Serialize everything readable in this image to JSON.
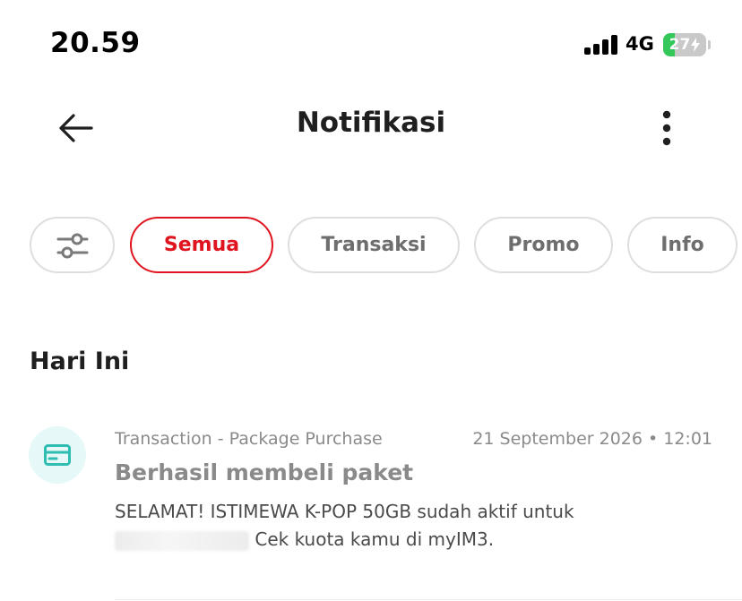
{
  "status_bar": {
    "time": "20.59",
    "network": "4G",
    "battery_percent": 27,
    "battery_label": "27"
  },
  "header": {
    "title": "Notifikasi",
    "back_icon": "arrow-left-icon",
    "more_icon": "more-vertical-icon"
  },
  "filters": {
    "filter_icon": "sliders-icon",
    "chips": [
      {
        "label": "Semua",
        "active": true
      },
      {
        "label": "Transaksi",
        "active": false
      },
      {
        "label": "Promo",
        "active": false
      },
      {
        "label": "Info",
        "active": false
      }
    ]
  },
  "section": {
    "title": "Hari Ini"
  },
  "notifications": [
    {
      "icon": "card-icon",
      "category": "Transaction - Package Purchase",
      "timestamp": "21 September 2026 • 12:01",
      "title": "Berhasil membeli paket",
      "body_line1": "SELAMAT! ISTIMEWA K-POP 50GB sudah aktif untuk",
      "body_line2_suffix": "Cek kuota kamu di myIM3."
    }
  ],
  "colors": {
    "accent": "#e0141e",
    "chip_border": "#dedede",
    "icon_bg": "#e6f8f7",
    "icon_fg": "#2ebdb0",
    "battery_fill": "#34c759"
  }
}
